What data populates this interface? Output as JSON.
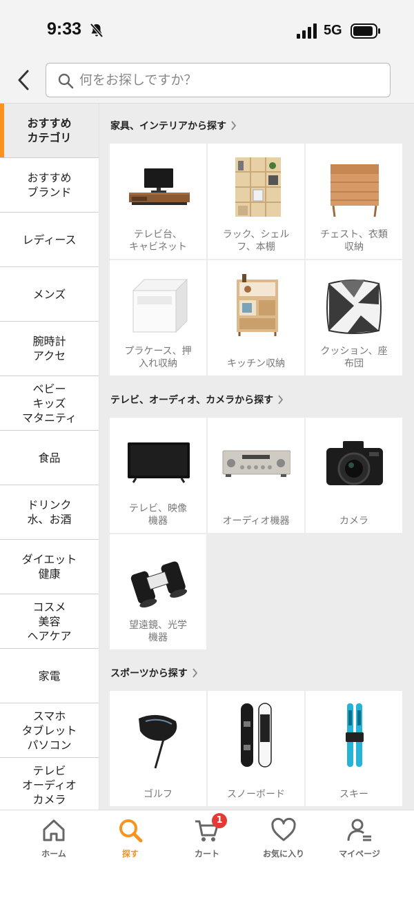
{
  "status_bar": {
    "time": "9:33",
    "network": "5G",
    "icons": [
      "bell-off-icon",
      "signal-icon",
      "battery-icon"
    ]
  },
  "search": {
    "placeholder": "何をお探しですか？",
    "icons": [
      "back-arrow-icon",
      "search-icon"
    ]
  },
  "colors": {
    "accent": "#f7931e",
    "badge": "#e53935",
    "panel_bg": "#ececec"
  },
  "sidebar": {
    "items": [
      {
        "label": "おすすめ\nカテゴリ",
        "active": true
      },
      {
        "label": "おすすめ\nブランド"
      },
      {
        "label": "レディース"
      },
      {
        "label": "メンズ"
      },
      {
        "label": "腕時計\nアクセ"
      },
      {
        "label": "ベビー\nキッズ\nマタニティ"
      },
      {
        "label": "食品"
      },
      {
        "label": "ドリンク\n水、お酒"
      },
      {
        "label": "ダイエット\n健康"
      },
      {
        "label": "コスメ\n美容\nヘアケア"
      },
      {
        "label": "家電"
      },
      {
        "label": "スマホ\nタブレット\nパソコン"
      },
      {
        "label": "テレビ\nオーディオ\nカメラ"
      }
    ]
  },
  "sections": [
    {
      "title": "家具、インテリアから探す",
      "cards": [
        {
          "label": "テレビ台、\nキャビネット",
          "icon": "tv-stand-icon"
        },
        {
          "label": "ラック、シェル\nフ、本棚",
          "icon": "bookshelf-icon"
        },
        {
          "label": "チェスト、衣類\n収納",
          "icon": "chest-icon"
        },
        {
          "label": "プラケース、押\n入れ収納",
          "icon": "storage-case-icon"
        },
        {
          "label": "キッチン収納",
          "icon": "kitchen-rack-icon"
        },
        {
          "label": "クッション、座\n布団",
          "icon": "cushion-icon"
        }
      ]
    },
    {
      "title": "テレビ、オーディオ、カメラから探す",
      "cards": [
        {
          "label": "テレビ、映像\n機器",
          "icon": "tv-icon"
        },
        {
          "label": "オーディオ機器",
          "icon": "amplifier-icon"
        },
        {
          "label": "カメラ",
          "icon": "camera-icon"
        },
        {
          "label": "望遠鏡、光学\n機器",
          "icon": "binoculars-icon"
        }
      ]
    },
    {
      "title": "スポーツから探す",
      "cards": [
        {
          "label": "ゴルフ",
          "icon": "golf-driver-icon"
        },
        {
          "label": "スノーボード",
          "icon": "snowboard-icon"
        },
        {
          "label": "スキー",
          "icon": "ski-icon"
        }
      ]
    }
  ],
  "bottom_nav": {
    "items": [
      {
        "label": "ホーム",
        "icon": "home-icon"
      },
      {
        "label": "探す",
        "icon": "search-icon",
        "active": true
      },
      {
        "label": "カート",
        "icon": "cart-icon",
        "badge": "1"
      },
      {
        "label": "お気に入り",
        "icon": "heart-icon"
      },
      {
        "label": "マイページ",
        "icon": "user-icon"
      }
    ]
  }
}
